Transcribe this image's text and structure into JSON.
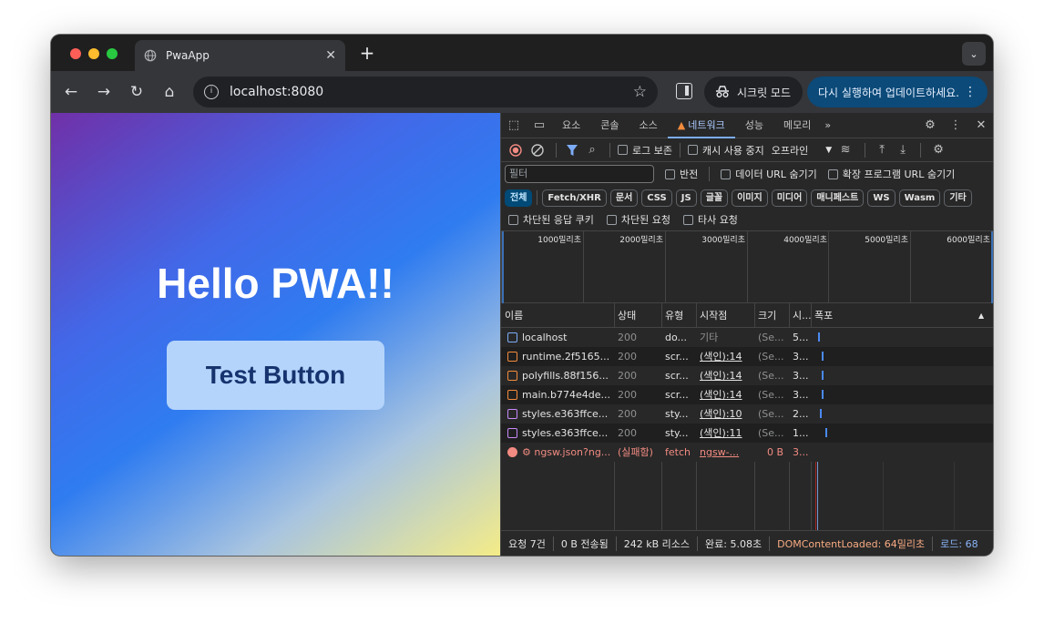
{
  "browser": {
    "tab_title": "PwaApp",
    "url": "localhost:8080",
    "incognito_label": "시크릿 모드",
    "update_label": "다시 실행하여 업데이트하세요."
  },
  "page": {
    "heading": "Hello PWA!!",
    "button_label": "Test Button"
  },
  "devtools": {
    "tabs": [
      "요소",
      "콘솔",
      "소스",
      "네트워크",
      "성능",
      "메모리"
    ],
    "active_tab": "네트워크",
    "more_tabs": "»",
    "preserve_log": "로그 보존",
    "disable_cache": "캐시 사용 중지",
    "throttle": "오프라인",
    "filter_placeholder": "필터",
    "invert": "반전",
    "hide_data_urls": "데이터 URL 숨기기",
    "hide_extension_urls": "확장 프로그램 URL 숨기기",
    "type_filters": [
      "전체",
      "Fetch/XHR",
      "문서",
      "CSS",
      "JS",
      "글꼴",
      "이미지",
      "미디어",
      "매니페스트",
      "WS",
      "Wasm",
      "기타"
    ],
    "blocked_cookies": "차단된 응답 쿠키",
    "blocked_requests": "차단된 요청",
    "third_party": "타사 요청",
    "timeline_ticks": [
      "1000밀리초",
      "2000밀리초",
      "3000밀리초",
      "4000밀리초",
      "5000밀리초",
      "6000밀리초"
    ],
    "columns": [
      "이름",
      "상태",
      "유형",
      "시작점",
      "크기",
      "시...",
      "폭포"
    ],
    "rows": [
      {
        "name": "localhost",
        "status": "200",
        "type": "do...",
        "initiator": "기타",
        "size": "(Se...",
        "time": "5...",
        "kind": "doc",
        "failed": false,
        "start": 0.02
      },
      {
        "name": "runtime.2f5165...",
        "status": "200",
        "type": "scr...",
        "initiator": "(색인):14",
        "size": "(Se...",
        "time": "3...",
        "kind": "script",
        "failed": false,
        "start": 0.04
      },
      {
        "name": "polyfills.88f156...",
        "status": "200",
        "type": "scr...",
        "initiator": "(색인):14",
        "size": "(Se...",
        "time": "3...",
        "kind": "script",
        "failed": false,
        "start": 0.04
      },
      {
        "name": "main.b774e4de...",
        "status": "200",
        "type": "scr...",
        "initiator": "(색인):14",
        "size": "(Se...",
        "time": "3...",
        "kind": "script",
        "failed": false,
        "start": 0.04
      },
      {
        "name": "styles.e363ffce...",
        "status": "200",
        "type": "sty...",
        "initiator": "(색인):10",
        "size": "(Se...",
        "time": "2...",
        "kind": "style",
        "failed": false,
        "start": 0.03
      },
      {
        "name": "styles.e363ffce...",
        "status": "200",
        "type": "sty...",
        "initiator": "(색인):11",
        "size": "(Se...",
        "time": "1...",
        "kind": "style",
        "failed": false,
        "start": 0.06
      },
      {
        "name": "⚙ ngsw.json?ng...",
        "status": "(실패함)",
        "type": "fetch",
        "initiator": "ngsw-...",
        "size": "0 B",
        "time": "3...",
        "kind": "error",
        "failed": true,
        "start": 0
      }
    ],
    "status_bar": {
      "requests": "요청 7건",
      "transferred": "0 B 전송됨",
      "resources": "242 kB 리소스",
      "finish": "완료: 5.08초",
      "dom_loaded": "DOMContentLoaded: 64밀리초",
      "load": "로드: 68"
    }
  },
  "colors": {
    "accent": "#7cacf8",
    "error": "#f28b82",
    "doc_icon": "#7cacf8",
    "script_icon": "#f28b3c",
    "style_icon": "#c58af9",
    "dom_loaded": "#f9ab83",
    "load": "#8ab4f8"
  }
}
